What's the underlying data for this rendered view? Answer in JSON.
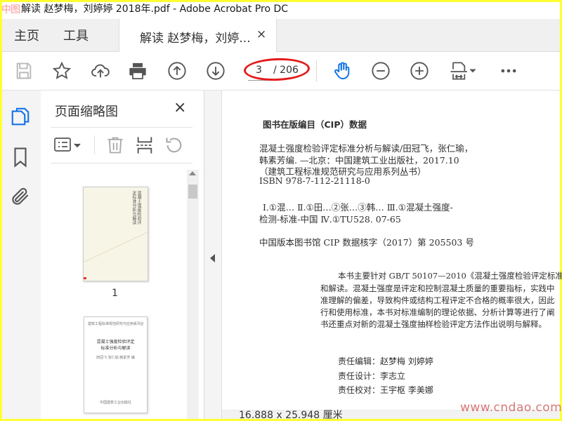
{
  "window": {
    "title": "解读 赵梦梅，刘婷婷 2018年.pdf - Adobe Acrobat Pro DC"
  },
  "watermarks": {
    "left": "中图",
    "right": "www.cndao.com"
  },
  "tabs": {
    "home": "主页",
    "tools": "工具",
    "document": "解读 赵梦梅，刘婷...",
    "close": "×"
  },
  "toolbar": {
    "page_current": "3",
    "page_total": "/ 206",
    "icons": [
      "save-icon",
      "star-icon",
      "cloud-upload-icon",
      "print-icon",
      "arrow-up-icon",
      "arrow-down-icon",
      "hand-icon",
      "zoom-out-icon",
      "zoom-in-icon",
      "page-fit-icon",
      "more-icon"
    ]
  },
  "thumbnail_panel": {
    "title": "页面缩略图",
    "close": "×",
    "page1_label": "1",
    "thumb2_lines": [
      "建筑工程标准规范研究与应用系列丛书",
      "混凝土强度检验评定",
      "标准分析与解读",
      "田冠飞 张仁瑜 韩素芳 编",
      "中国建筑工业出版社"
    ]
  },
  "document": {
    "lines": [
      "图书在版编目（CIP）数据",
      "混凝土强度检验评定标准分析与解读/田冠飞，张仁瑜，",
      "韩素芳编. —北京：中国建筑工业出版社，2017.10",
      "（建筑工程标准规范研究与应用系列丛书）",
      "ISBN 978-7-112-21118-0",
      "Ⅰ.①混… Ⅱ.①田…②张…③韩… Ⅲ.①混凝土强度-",
      "检测-标准-中国 Ⅳ.①TU528. 07-65",
      "中国版本图书馆 CIP 数据核字（2017）第 205503 号",
      "本书主要针对 GB/T 50107—2010《混凝土强度检验评定标准",
      "和解读。混凝土强度是评定和控制混凝土质量的重要指标，实践中",
      "准理解的偏差，导致构件或结构工程评定不合格的概率很大，因此",
      "行和使用标准，本书对标准编制的理论依据、分析计算等进行了阐",
      "书还重点对新的混凝土强度抽样检验评定方法作出说明与解释。",
      "责任编辑：赵梦梅 刘婷婷",
      "责任设计：李志立",
      "责任校对：王宇枢 李美娜"
    ]
  },
  "status": {
    "page_size": "16.888 x 25.948 厘米"
  },
  "colors": {
    "accent_blue": "#1473e6",
    "annotation_red": "#e41b1b",
    "frame_yellow": "#ffff33"
  }
}
